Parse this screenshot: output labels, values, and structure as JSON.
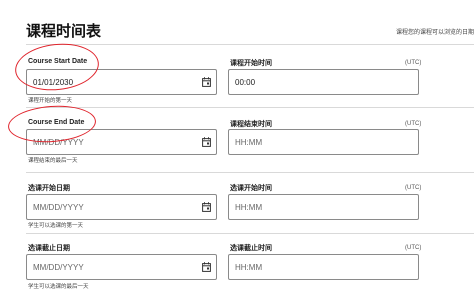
{
  "page": {
    "title": "课程时间表",
    "note": "课程您的课程可以浏览的日期"
  },
  "sections": [
    {
      "date_label": "Course Start Date",
      "date_value": "01/01/2030",
      "date_placeholder": "MM/DD/YYYY",
      "date_help": "课程开始的第一天",
      "time_label": "课程开始时间",
      "time_value": "00:00",
      "time_placeholder": "HH:MM",
      "time_zone": "(UTC)"
    },
    {
      "date_label": "Course End Date",
      "date_value": "",
      "date_placeholder": "MM/DD/YYYY",
      "date_help": "课程结束的最后一天",
      "time_label": "课程结束时间",
      "time_value": "",
      "time_placeholder": "HH:MM",
      "time_zone": "(UTC)"
    },
    {
      "date_label": "选课开始日期",
      "date_value": "",
      "date_placeholder": "MM/DD/YYYY",
      "date_help": "学生可以选课的第一天",
      "time_label": "选课开始时间",
      "time_value": "",
      "time_placeholder": "HH:MM",
      "time_zone": "(UTC)"
    },
    {
      "date_label": "选课截止日期",
      "date_value": "",
      "date_placeholder": "MM/DD/YYYY",
      "date_help": "学生可以选课的最后一天",
      "time_label": "选课截止时间",
      "time_value": "",
      "time_placeholder": "HH:MM",
      "time_zone": "(UTC)"
    }
  ],
  "icons": {
    "calendar": "calendar-icon"
  },
  "colors": {
    "annotation": "#e0242c",
    "border": "#8a8a8a"
  }
}
